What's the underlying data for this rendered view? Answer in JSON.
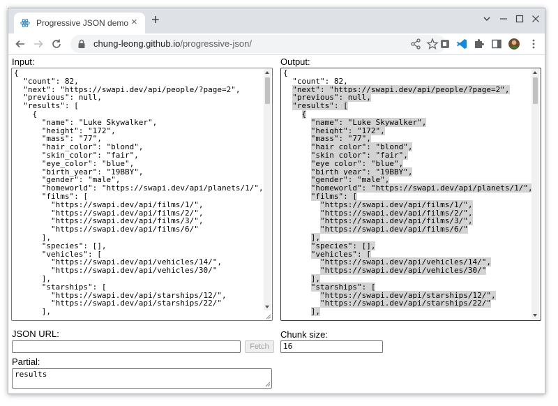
{
  "browser": {
    "tab_title": "Progressive JSON demo",
    "new_tab_label": "+",
    "url_host": "chung-leong.github.io",
    "url_path": "/progressive-json/"
  },
  "input": {
    "label": "Input:",
    "lines": [
      "{",
      "  \"count\": 82,",
      "  \"next\": \"https://swapi.dev/api/people/?page=2\",",
      "  \"previous\": null,",
      "  \"results\": [",
      "    {",
      "      \"name\": \"Luke Skywalker\",",
      "      \"height\": \"172\",",
      "      \"mass\": \"77\",",
      "      \"hair_color\": \"blond\",",
      "      \"skin_color\": \"fair\",",
      "      \"eye_color\": \"blue\",",
      "      \"birth_year\": \"19BBY\",",
      "      \"gender\": \"male\",",
      "      \"homeworld\": \"https://swapi.dev/api/planets/1/\",",
      "      \"films\": [",
      "        \"https://swapi.dev/api/films/1/\",",
      "        \"https://swapi.dev/api/films/2/\",",
      "        \"https://swapi.dev/api/films/3/\",",
      "        \"https://swapi.dev/api/films/6/\"",
      "      ],",
      "      \"species\": [],",
      "      \"vehicles\": [",
      "        \"https://swapi.dev/api/vehicles/14/\",",
      "        \"https://swapi.dev/api/vehicles/30/\"",
      "      ],",
      "      \"starships\": [",
      "        \"https://swapi.dev/api/starships/12/\",",
      "        \"https://swapi.dev/api/starships/22/\"",
      "      ],"
    ]
  },
  "output": {
    "label": "Output:",
    "lines": [
      [
        "{",
        false
      ],
      [
        "  \"count\": 82,",
        false
      ],
      [
        "  \"next\": \"https://swapi.dev/api/people/?page=2\",",
        true
      ],
      [
        "  \"previous\": null,",
        true
      ],
      [
        "  \"results\": [",
        true
      ],
      [
        "    {",
        true
      ],
      [
        "      \"name\": \"Luke Skywalker\",",
        true
      ],
      [
        "      \"height\": \"172\",",
        true
      ],
      [
        "      \"mass\": \"77\",",
        true
      ],
      [
        "      \"hair_color\": \"blond\",",
        true
      ],
      [
        "      \"skin_color\": \"fair\",",
        true
      ],
      [
        "      \"eye_color\": \"blue\",",
        true
      ],
      [
        "      \"birth_year\": \"19BBY\",",
        true
      ],
      [
        "      \"gender\": \"male\",",
        true
      ],
      [
        "      \"homeworld\": \"https://swapi.dev/api/planets/1/\",",
        true
      ],
      [
        "      \"films\": [",
        true
      ],
      [
        "        \"https://swapi.dev/api/films/1/\",",
        true
      ],
      [
        "        \"https://swapi.dev/api/films/2/\",",
        true
      ],
      [
        "        \"https://swapi.dev/api/films/3/\",",
        true
      ],
      [
        "        \"https://swapi.dev/api/films/6/\"",
        true
      ],
      [
        "      ],",
        true
      ],
      [
        "      \"species\": [],",
        true
      ],
      [
        "      \"vehicles\": [",
        true
      ],
      [
        "        \"https://swapi.dev/api/vehicles/14/\",",
        true
      ],
      [
        "        \"https://swapi.dev/api/vehicles/30/\"",
        true
      ],
      [
        "      ],",
        true
      ],
      [
        "      \"starships\": [",
        true
      ],
      [
        "        \"https://swapi.dev/api/starships/12/\",",
        true
      ],
      [
        "        \"https://swapi.dev/api/starships/22/\"",
        true
      ],
      [
        "      ],",
        true
      ]
    ]
  },
  "json_url": {
    "label": "JSON URL:",
    "value": "",
    "fetch_label": "Fetch"
  },
  "chunk_size": {
    "label": "Chunk size:",
    "value": "16"
  },
  "partial": {
    "label": "Partial:",
    "value": "results"
  },
  "colors": {
    "highlight": "#d3d3d3",
    "chrome_frame": "#dee1e6",
    "omnibox": "#f1f3f4"
  }
}
